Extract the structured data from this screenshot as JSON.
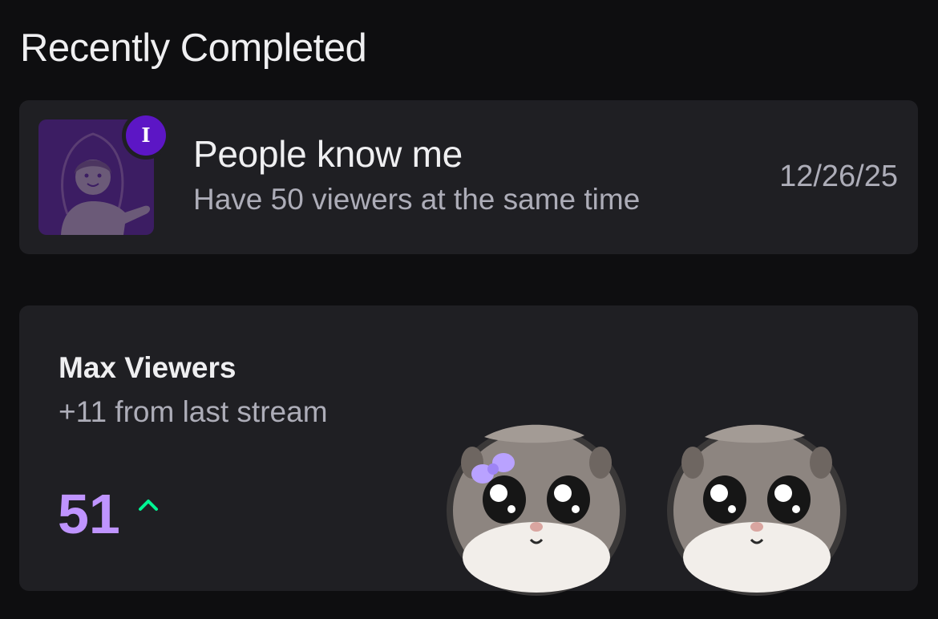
{
  "section": {
    "title": "Recently Completed"
  },
  "achievement": {
    "icon": "person-presenting-icon",
    "tier_badge": "I",
    "title": "People know me",
    "description": "Have 50 viewers at the same time",
    "date": "12/26/25",
    "colors": {
      "icon_bg": "#3c1d63",
      "badge": "#5c16c5"
    }
  },
  "stat": {
    "label": "Max Viewers",
    "change": "+11 from last stream",
    "value": "51",
    "trend": "up",
    "colors": {
      "value": "#bf94ff",
      "trend": "#00f593"
    }
  },
  "emotes": [
    "hamster-emote-with-bow",
    "hamster-emote"
  ]
}
